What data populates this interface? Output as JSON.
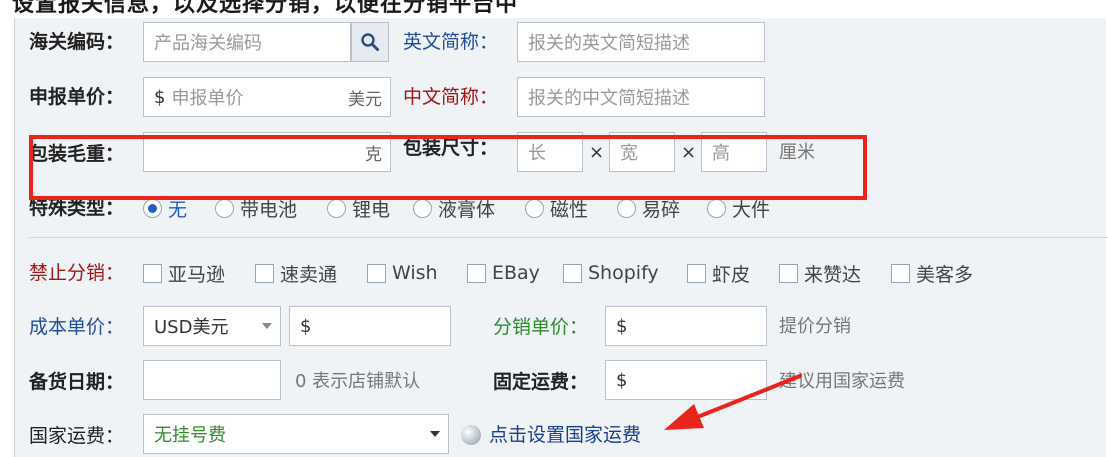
{
  "header_fragment": "设置报关信息，以及选择分销，以便在分销平台中",
  "customs": {
    "hs_code": {
      "label": "海关编码：",
      "placeholder": "产品海关编码"
    },
    "en_name": {
      "label": "英文简称：",
      "placeholder": "报关的英文简短描述"
    },
    "declared_price": {
      "label": "申报单价：",
      "prefix": "$",
      "placeholder": "申报单价",
      "unit": "美元"
    },
    "cn_name": {
      "label": "中文简称：",
      "placeholder": "报关的中文简短描述"
    },
    "gross_weight": {
      "label": "包装毛重：",
      "value": "",
      "unit": "克"
    },
    "package_size": {
      "label": "包装尺寸：",
      "length_placeholder": "长",
      "width_placeholder": "宽",
      "height_placeholder": "高",
      "times": "×",
      "unit": "厘米"
    }
  },
  "special_type": {
    "label": "特殊类型：",
    "options": [
      "无",
      "带电池",
      "锂电",
      "液膏体",
      "磁性",
      "易碎",
      "大件"
    ],
    "selected": "无"
  },
  "distribution": {
    "forbid_label": "禁止分销：",
    "platforms": [
      "亚马逊",
      "速卖通",
      "Wish",
      "EBay",
      "Shopify",
      "虾皮",
      "来赞达",
      "美客多"
    ],
    "cost_price": {
      "label": "成本单价：",
      "currency": "USD美元",
      "prefix": "$"
    },
    "dist_price": {
      "label": "分销单价：",
      "prefix": "$",
      "hint": "提价分销"
    },
    "stock_days": {
      "label": "备货日期：",
      "hint": "0 表示店铺默认"
    },
    "fixed_freight": {
      "label": "固定运费：",
      "prefix": "$",
      "hint": "建议用国家运费"
    },
    "country_freight": {
      "label": "国家运费：",
      "selected": "无挂号费",
      "link": "点击设置国家运费"
    }
  },
  "colors": {
    "highlight": "#e8241c",
    "arrow": "#e8241c",
    "label_blue": "#1f4f9a",
    "label_red": "#a31515",
    "label_green": "#2e8b2e",
    "link": "#1a3f8f",
    "radio_selected": "#1f5fbf",
    "panel_bg": "#f0f3f6"
  },
  "icons": [
    "search-icon",
    "chevron-down-icon",
    "globe-icon",
    "red-arrow-annotation"
  ]
}
